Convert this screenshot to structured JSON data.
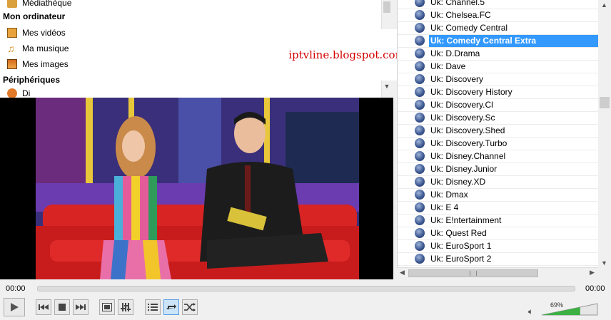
{
  "sidebar": {
    "top_item": "Médiathèque",
    "my_computer_heading": "Mon ordinateur",
    "my_computer_items": [
      "Mes vidéos",
      "Ma musique",
      "Mes images"
    ],
    "devices_heading": "Périphériques",
    "devices_item_partial": "Di"
  },
  "watermark": "iptvline.blogspot.com",
  "playlist": {
    "selected_index": 3,
    "items": [
      "Uk: Channel.5",
      "Uk: Chelsea.FC",
      "Uk: Comedy Central",
      "Uk: Comedy Central Extra",
      "Uk: D.Drama",
      "Uk: Dave",
      "Uk: Discovery",
      "Uk: Discovery History",
      "Uk: Discovery.Cl",
      "Uk: Discovery.Sc",
      "Uk: Discovery.Shed",
      "Uk: Discovery.Turbo",
      "Uk: Disney.Channel",
      "Uk: Disney.Junior",
      "Uk: Disney.XD",
      "Uk: Dmax",
      "Uk: E 4",
      "Uk: E!ntertainment",
      "Uk: Quest Red",
      "Uk: EuroSport 1",
      "Uk: EuroSport 2"
    ]
  },
  "player": {
    "elapsed": "00:00",
    "remaining": "00:00",
    "volume_label": "69%",
    "volume_fraction": 0.69,
    "progress_fraction": 0.0
  },
  "controls": {
    "play": "play-icon",
    "prev": "previous-icon",
    "stop": "stop-icon",
    "next": "next-icon",
    "fullscreen": "fullscreen-icon",
    "extended": "equalizer-icon",
    "playlist": "playlist-icon",
    "loop": "loop-icon",
    "random": "shuffle-icon"
  },
  "colors": {
    "selection": "#3399ff",
    "volume_fill": "#3cb043",
    "watermark": "#d40000"
  }
}
